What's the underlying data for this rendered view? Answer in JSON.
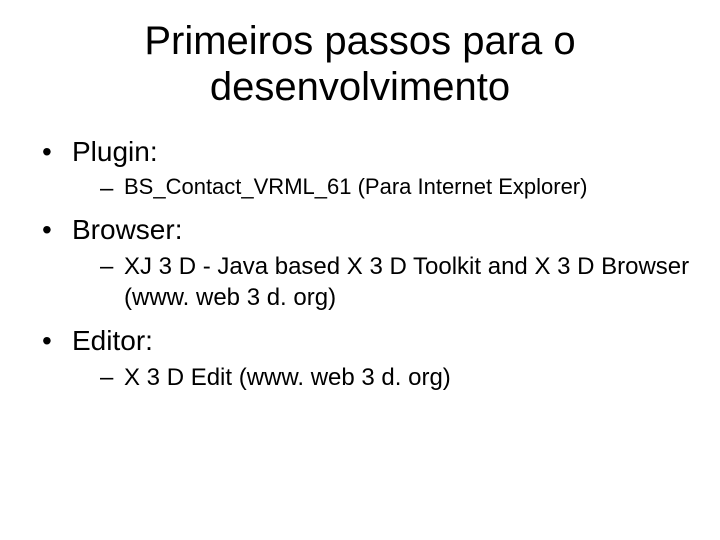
{
  "title": "Primeiros passos para o desenvolvimento",
  "items": [
    {
      "label": "Plugin:",
      "sub": [
        "BS_Contact_VRML_61 (Para Internet Explorer)"
      ],
      "sub_small": true
    },
    {
      "label": "Browser:",
      "sub": [
        "XJ 3 D - Java based X 3 D Toolkit and X 3 D Browser (www. web 3 d. org)"
      ],
      "sub_small": false
    },
    {
      "label": "Editor:",
      "sub": [
        "X 3 D Edit (www. web 3 d. org)"
      ],
      "sub_small": false
    }
  ]
}
